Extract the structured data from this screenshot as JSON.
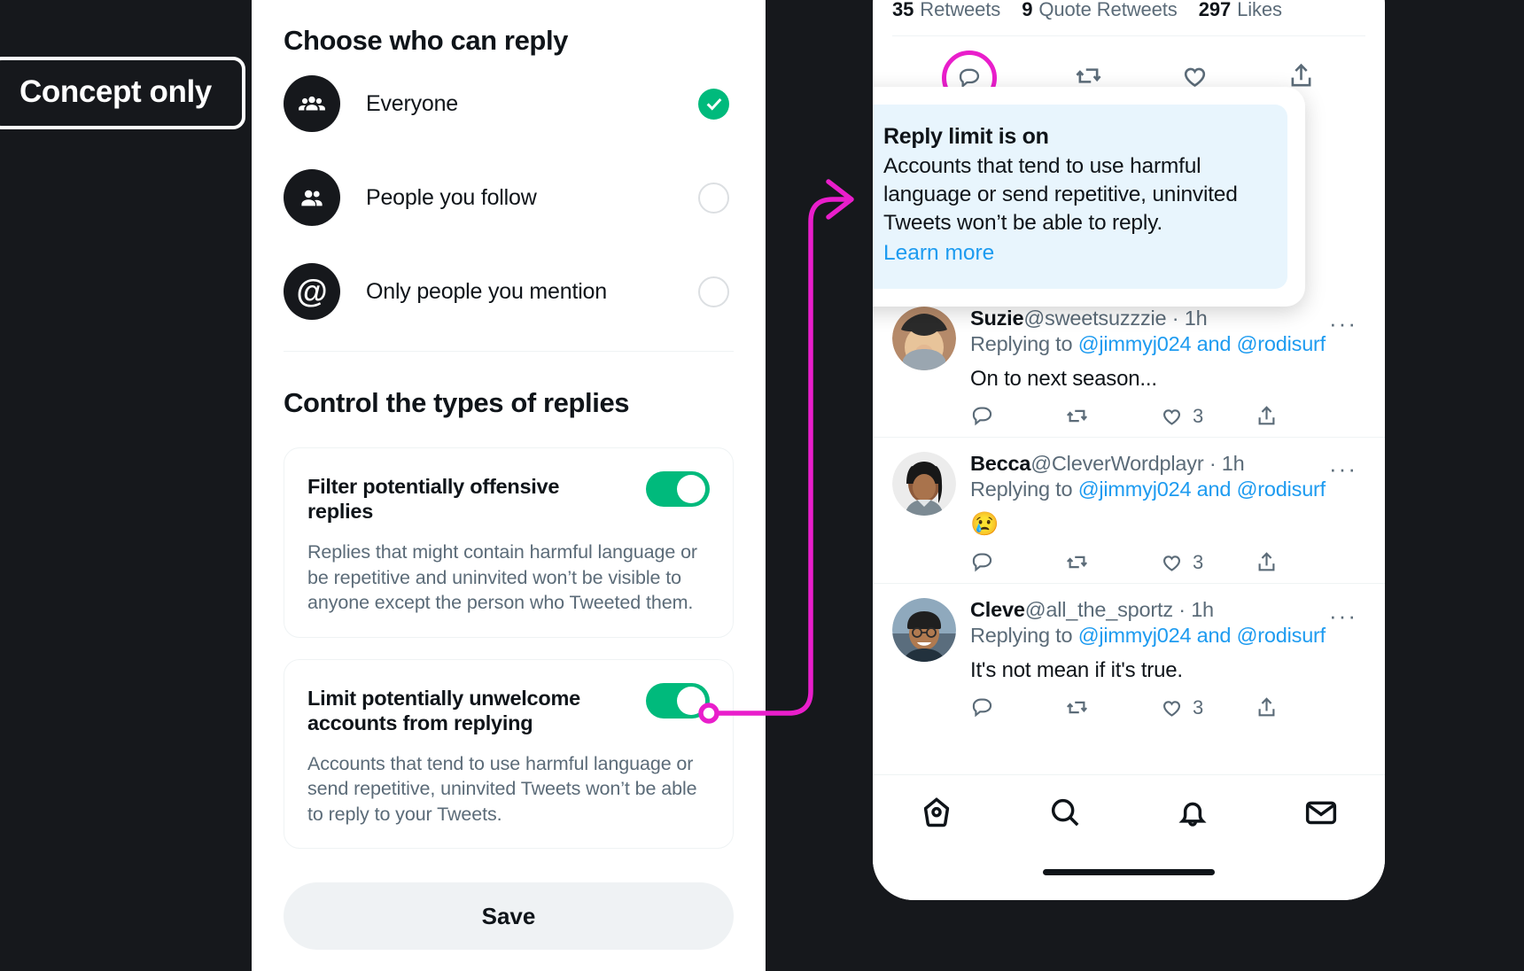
{
  "badge": {
    "label": "Concept only"
  },
  "settings": {
    "section1_title": "Choose who can reply",
    "options": [
      {
        "label": "Everyone",
        "icon": "group-of-three-icon",
        "selected": true
      },
      {
        "label": "People you follow",
        "icon": "group-of-two-icon",
        "selected": false
      },
      {
        "label": "Only people you mention",
        "icon": "at-sign-icon",
        "selected": false
      }
    ],
    "section2_title": "Control the types of replies",
    "cards": [
      {
        "title": "Filter potentially offensive replies",
        "description": "Replies that might contain harmful language or be repetitive and uninvited won’t be visible to anyone except the person who Tweeted them.",
        "toggle_on": true
      },
      {
        "title": "Limit potentially unwelcome accounts from replying",
        "description": "Accounts that tend to use harmful language or send repetitive, uninvited Tweets won’t be able to reply to your Tweets.",
        "toggle_on": true
      }
    ],
    "save_label": "Save"
  },
  "phone": {
    "stats": [
      {
        "count": "35",
        "label": "Retweets"
      },
      {
        "count": "9",
        "label": "Quote Retweets"
      },
      {
        "count": "297",
        "label": "Likes"
      }
    ],
    "actions": [
      "reply-icon",
      "retweet-icon",
      "like-icon",
      "share-icon"
    ],
    "tooltip": {
      "title": "Reply limit is on",
      "text": "Accounts that tend to use harmful language or send repetitive, uninvited Tweets won’t be able to reply.",
      "link": "Learn more",
      "icon": "shield-speech-bubble-icon",
      "accent": "#1d9bf0",
      "background": "#e8f5fd"
    },
    "tweets": [
      {
        "name": "Suzie",
        "handle": "@sweetsuzzzie",
        "time": "1h",
        "replying_prefix": "Replying to ",
        "replying_to": "@jimmyj024 and @rodisurf",
        "text": "On to next season...",
        "emoji": "",
        "like_count": "3",
        "more": "···"
      },
      {
        "name": "Becca",
        "handle": "@CleverWordplayr",
        "time": "1h",
        "replying_prefix": "Replying to ",
        "replying_to": "@jimmyj024 and @rodisurf",
        "text": "",
        "emoji": "😢",
        "like_count": "3",
        "more": "···"
      },
      {
        "name": "Cleve",
        "handle": "@all_the_sportz",
        "time": "1h",
        "replying_prefix": "Replying to ",
        "replying_to": "@jimmyj024 and @rodisurf",
        "text": "It's not mean if it's true.",
        "emoji": "",
        "like_count": "3",
        "more": "···"
      }
    ],
    "bottom_nav": [
      "home-icon",
      "search-icon",
      "notifications-icon",
      "messages-icon"
    ]
  },
  "colors": {
    "background": "#16181c",
    "toggle_on": "#00ba7c",
    "connector": "#e91ecb",
    "link": "#1d9bf0"
  }
}
